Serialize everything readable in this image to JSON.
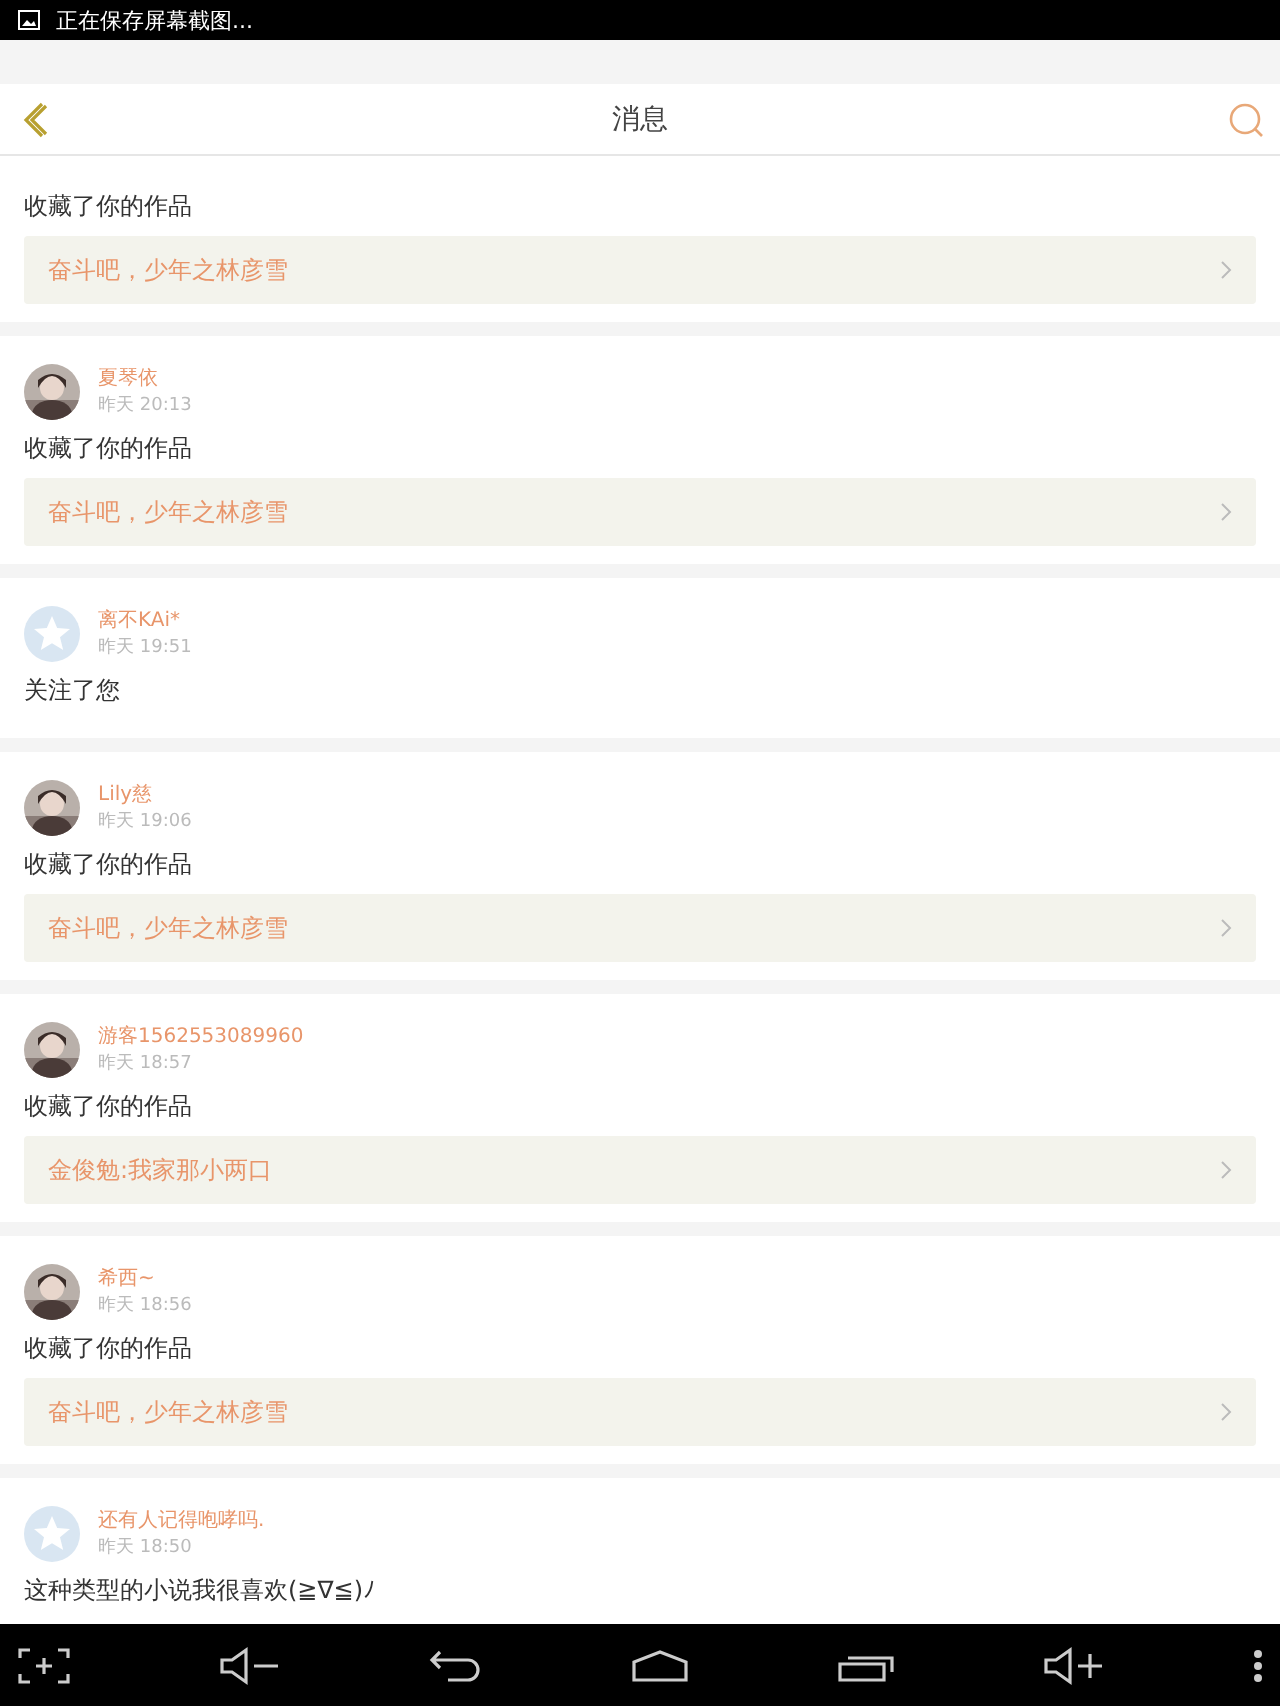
{
  "status_bar": {
    "notification": "正在保存屏幕截图..."
  },
  "header": {
    "title": "消息"
  },
  "messages": [
    {
      "action": "收藏了你的作品",
      "link": "奋斗吧，少年之林彦雪"
    },
    {
      "name": "夏琴依",
      "time": "昨天 20:13",
      "action": "收藏了你的作品",
      "link": "奋斗吧，少年之林彦雪"
    },
    {
      "avatar": {
        "kind": "default"
      },
      "name": "离不KAi*",
      "time": "昨天 19:51",
      "action": "关注了您"
    },
    {
      "name": "Lily慈",
      "time": "昨天 19:06",
      "action": "收藏了你的作品",
      "link": "奋斗吧，少年之林彦雪"
    },
    {
      "name": "游客1562553089960",
      "time": "昨天 18:57",
      "action": "收藏了你的作品",
      "link": "金俊勉:我家那小两口"
    },
    {
      "name": "希西~",
      "time": "昨天 18:56",
      "action": "收藏了你的作品",
      "link": "奋斗吧，少年之林彦雪"
    },
    {
      "avatar": {
        "kind": "default"
      },
      "name": "还有人记得咆哮吗.",
      "time": "昨天 18:50",
      "action": "这种类型的小说我很喜欢(≧∇≦)ﾉ"
    }
  ]
}
